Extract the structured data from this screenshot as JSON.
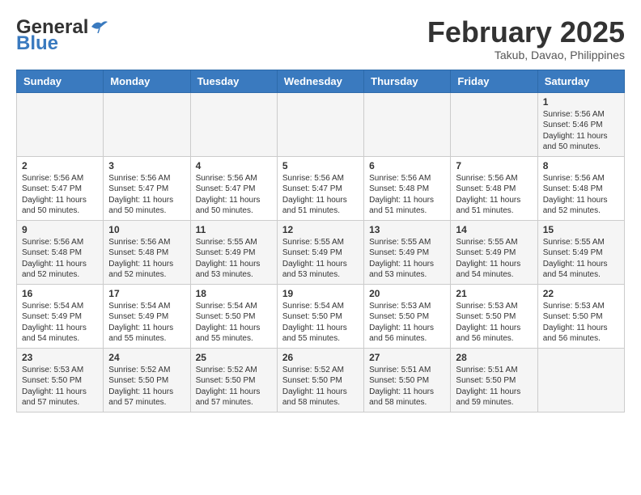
{
  "header": {
    "logo_general": "General",
    "logo_blue": "Blue",
    "month_year": "February 2025",
    "location": "Takub, Davao, Philippines"
  },
  "weekdays": [
    "Sunday",
    "Monday",
    "Tuesday",
    "Wednesday",
    "Thursday",
    "Friday",
    "Saturday"
  ],
  "weeks": [
    [
      {
        "day": "",
        "info": ""
      },
      {
        "day": "",
        "info": ""
      },
      {
        "day": "",
        "info": ""
      },
      {
        "day": "",
        "info": ""
      },
      {
        "day": "",
        "info": ""
      },
      {
        "day": "",
        "info": ""
      },
      {
        "day": "1",
        "info": "Sunrise: 5:56 AM\nSunset: 5:46 PM\nDaylight: 11 hours\nand 50 minutes."
      }
    ],
    [
      {
        "day": "2",
        "info": "Sunrise: 5:56 AM\nSunset: 5:47 PM\nDaylight: 11 hours\nand 50 minutes."
      },
      {
        "day": "3",
        "info": "Sunrise: 5:56 AM\nSunset: 5:47 PM\nDaylight: 11 hours\nand 50 minutes."
      },
      {
        "day": "4",
        "info": "Sunrise: 5:56 AM\nSunset: 5:47 PM\nDaylight: 11 hours\nand 50 minutes."
      },
      {
        "day": "5",
        "info": "Sunrise: 5:56 AM\nSunset: 5:47 PM\nDaylight: 11 hours\nand 51 minutes."
      },
      {
        "day": "6",
        "info": "Sunrise: 5:56 AM\nSunset: 5:48 PM\nDaylight: 11 hours\nand 51 minutes."
      },
      {
        "day": "7",
        "info": "Sunrise: 5:56 AM\nSunset: 5:48 PM\nDaylight: 11 hours\nand 51 minutes."
      },
      {
        "day": "8",
        "info": "Sunrise: 5:56 AM\nSunset: 5:48 PM\nDaylight: 11 hours\nand 52 minutes."
      }
    ],
    [
      {
        "day": "9",
        "info": "Sunrise: 5:56 AM\nSunset: 5:48 PM\nDaylight: 11 hours\nand 52 minutes."
      },
      {
        "day": "10",
        "info": "Sunrise: 5:56 AM\nSunset: 5:48 PM\nDaylight: 11 hours\nand 52 minutes."
      },
      {
        "day": "11",
        "info": "Sunrise: 5:55 AM\nSunset: 5:49 PM\nDaylight: 11 hours\nand 53 minutes."
      },
      {
        "day": "12",
        "info": "Sunrise: 5:55 AM\nSunset: 5:49 PM\nDaylight: 11 hours\nand 53 minutes."
      },
      {
        "day": "13",
        "info": "Sunrise: 5:55 AM\nSunset: 5:49 PM\nDaylight: 11 hours\nand 53 minutes."
      },
      {
        "day": "14",
        "info": "Sunrise: 5:55 AM\nSunset: 5:49 PM\nDaylight: 11 hours\nand 54 minutes."
      },
      {
        "day": "15",
        "info": "Sunrise: 5:55 AM\nSunset: 5:49 PM\nDaylight: 11 hours\nand 54 minutes."
      }
    ],
    [
      {
        "day": "16",
        "info": "Sunrise: 5:54 AM\nSunset: 5:49 PM\nDaylight: 11 hours\nand 54 minutes."
      },
      {
        "day": "17",
        "info": "Sunrise: 5:54 AM\nSunset: 5:49 PM\nDaylight: 11 hours\nand 55 minutes."
      },
      {
        "day": "18",
        "info": "Sunrise: 5:54 AM\nSunset: 5:50 PM\nDaylight: 11 hours\nand 55 minutes."
      },
      {
        "day": "19",
        "info": "Sunrise: 5:54 AM\nSunset: 5:50 PM\nDaylight: 11 hours\nand 55 minutes."
      },
      {
        "day": "20",
        "info": "Sunrise: 5:53 AM\nSunset: 5:50 PM\nDaylight: 11 hours\nand 56 minutes."
      },
      {
        "day": "21",
        "info": "Sunrise: 5:53 AM\nSunset: 5:50 PM\nDaylight: 11 hours\nand 56 minutes."
      },
      {
        "day": "22",
        "info": "Sunrise: 5:53 AM\nSunset: 5:50 PM\nDaylight: 11 hours\nand 56 minutes."
      }
    ],
    [
      {
        "day": "23",
        "info": "Sunrise: 5:53 AM\nSunset: 5:50 PM\nDaylight: 11 hours\nand 57 minutes."
      },
      {
        "day": "24",
        "info": "Sunrise: 5:52 AM\nSunset: 5:50 PM\nDaylight: 11 hours\nand 57 minutes."
      },
      {
        "day": "25",
        "info": "Sunrise: 5:52 AM\nSunset: 5:50 PM\nDaylight: 11 hours\nand 57 minutes."
      },
      {
        "day": "26",
        "info": "Sunrise: 5:52 AM\nSunset: 5:50 PM\nDaylight: 11 hours\nand 58 minutes."
      },
      {
        "day": "27",
        "info": "Sunrise: 5:51 AM\nSunset: 5:50 PM\nDaylight: 11 hours\nand 58 minutes."
      },
      {
        "day": "28",
        "info": "Sunrise: 5:51 AM\nSunset: 5:50 PM\nDaylight: 11 hours\nand 59 minutes."
      },
      {
        "day": "",
        "info": ""
      }
    ]
  ]
}
